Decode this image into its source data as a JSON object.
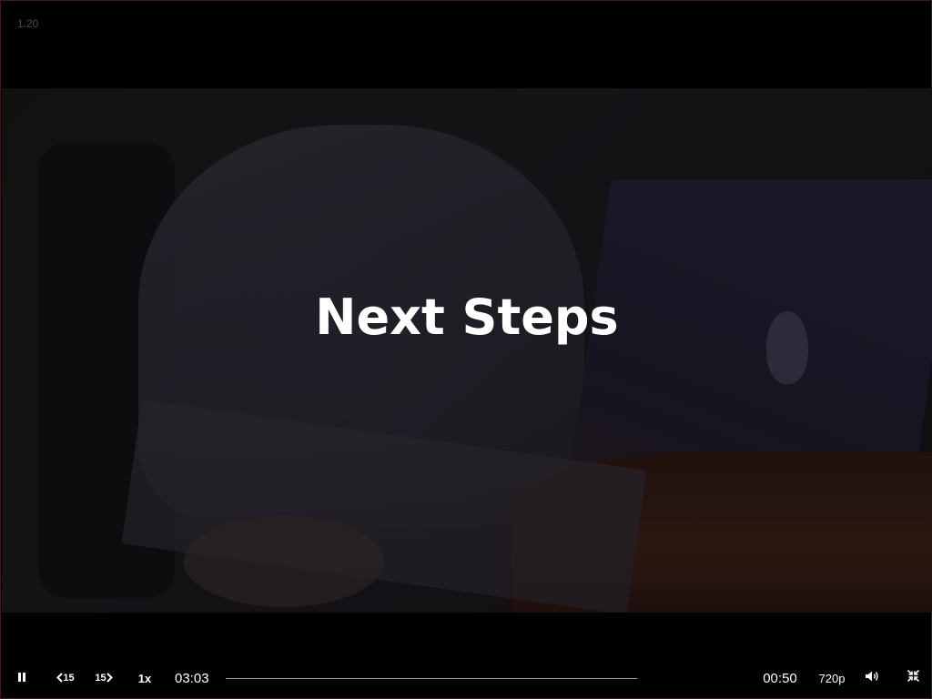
{
  "player": {
    "version": "1.20",
    "slide_title": "Next Steps"
  },
  "controls": {
    "pause_icon": "pause-icon",
    "skip_back_label": "15",
    "skip_forward_label": "15",
    "speed": "1x",
    "current_time": "03:03",
    "remaining_time": "00:50",
    "quality": "720p",
    "volume_icon": "volume-icon",
    "exit_fullscreen_icon": "exit-fullscreen-icon"
  },
  "colors": {
    "background": "#000000",
    "text": "#ffffff",
    "progress_track": "#9a9a9a"
  }
}
